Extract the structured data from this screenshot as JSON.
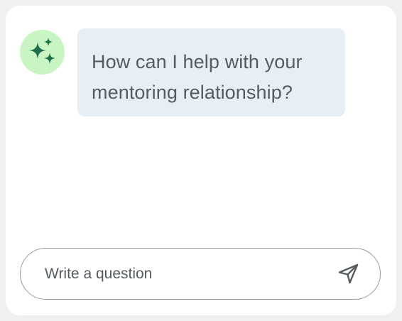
{
  "assistant": {
    "avatar_icon": "sparkles-icon",
    "avatar_bg": "#c9f5c3",
    "icon_color": "#1f6e4a",
    "message": "How can I help with your mentoring relationship?"
  },
  "composer": {
    "placeholder": "Write a question",
    "value": "",
    "send_icon": "send-icon"
  }
}
